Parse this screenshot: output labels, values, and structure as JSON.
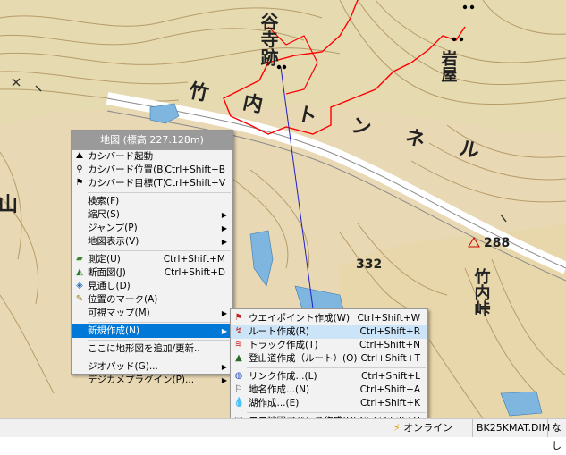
{
  "map": {
    "labels": [
      "谷寺跡",
      "岩屋",
      "竹内トンネル",
      "山",
      "288",
      "332",
      "竹内峠"
    ],
    "cursor_icon": "pointer-cursor-icon"
  },
  "context_menu": {
    "title": "地図 (標高 227.128m)",
    "items": [
      {
        "label": "カシバード起動",
        "shortcut": "",
        "icon": "kashmir-start-icon"
      },
      {
        "label": "カシバード位置(B)",
        "shortcut": "Ctrl+Shift+B",
        "icon": "kashmir-pos-icon"
      },
      {
        "label": "カシバード目標(T)",
        "shortcut": "Ctrl+Shift+V",
        "icon": "kashmir-target-icon"
      },
      {
        "label": "検索(F)",
        "shortcut": "",
        "icon": ""
      },
      {
        "label": "縮尺(S)",
        "shortcut": "",
        "icon": ""
      },
      {
        "label": "ジャンプ(P)",
        "shortcut": "",
        "icon": ""
      },
      {
        "label": "地図表示(V)",
        "shortcut": "",
        "icon": ""
      },
      {
        "label": "測定(U)",
        "shortcut": "Ctrl+Shift+M",
        "icon": "ruler-icon"
      },
      {
        "label": "断面図(J)",
        "shortcut": "Ctrl+Shift+D",
        "icon": "profile-icon"
      },
      {
        "label": "見通し(D)",
        "shortcut": "",
        "icon": "sight-icon"
      },
      {
        "label": "位置のマーク(A)",
        "shortcut": "",
        "icon": "pin-icon"
      },
      {
        "label": "可視マップ(M)",
        "shortcut": "",
        "icon": ""
      },
      {
        "label": "新規作成(N)",
        "shortcut": "",
        "icon": ""
      },
      {
        "label": "ここに地形図を追加/更新..",
        "shortcut": "",
        "icon": ""
      },
      {
        "label": "ジオパッド(G)...",
        "shortcut": "",
        "icon": ""
      },
      {
        "label": "デジカメプラグイン(P)...",
        "shortcut": "",
        "icon": ""
      }
    ]
  },
  "submenu": {
    "items": [
      {
        "label": "ウエイポイント作成(W)",
        "shortcut": "Ctrl+Shift+W",
        "icon": "waypoint-icon"
      },
      {
        "label": "ルート作成(R)",
        "shortcut": "Ctrl+Shift+R",
        "icon": "route-icon"
      },
      {
        "label": "トラック作成(T)",
        "shortcut": "Ctrl+Shift+N",
        "icon": "track-icon"
      },
      {
        "label": "登山道作成（ルート）(O)",
        "shortcut": "Ctrl+Shift+T",
        "icon": "trail-icon"
      },
      {
        "label": "リンク作成...(L)",
        "shortcut": "Ctrl+Shift+L",
        "icon": "link-icon"
      },
      {
        "label": "地名作成...(N)",
        "shortcut": "Ctrl+Shift+A",
        "icon": "placename-icon"
      },
      {
        "label": "湖作成...(E)",
        "shortcut": "Ctrl+Shift+K",
        "icon": "lake-icon"
      },
      {
        "label": "ココ地図アドレス作成(U)",
        "shortcut": "Ctrl+Shift+U",
        "icon": "address-icon"
      }
    ]
  },
  "statusbar": {
    "online": "オンライン",
    "file": "BK25KMAT.DIM",
    "extra": "なし"
  },
  "colors": {
    "map_bg": "#e9d8b4",
    "contour": "#b79c6a",
    "water": "#7fb6e0",
    "track": "#ff0000",
    "menu_highlight": "#0078d7",
    "submenu_hover": "#cce4f7"
  }
}
